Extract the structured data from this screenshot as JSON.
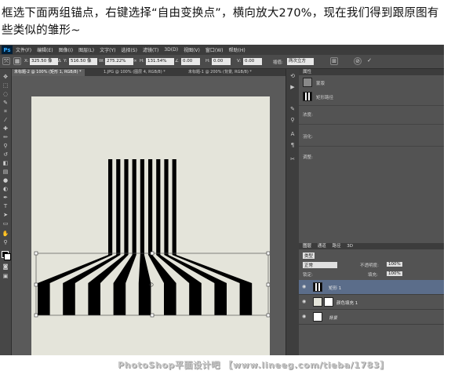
{
  "caption": "框选下面两组锚点，右键选择“自由变换点”，横向放大270%，现在我们得到跟原图有些类似的雏形~",
  "app": {
    "logo": "Ps",
    "menu": [
      "文件(F)",
      "编辑(E)",
      "图像(I)",
      "图层(L)",
      "文字(Y)",
      "选择(S)",
      "滤镜(T)",
      "3D(D)",
      "视图(V)",
      "窗口(W)",
      "帮助(H)"
    ]
  },
  "options": {
    "x_label": "X:",
    "x_value": "325.50 像",
    "y_label": "Y:",
    "y_value": "516.50 像",
    "w_label": "W:",
    "w_value": "275.22%",
    "h_label": "H:",
    "h_value": "131.54%",
    "angle_value": "0.00",
    "h_skew_label": "H:",
    "h_skew_value": "0.00",
    "v_skew_label": "V:",
    "v_skew_value": "0.00",
    "interp_label": "插值:",
    "interp_value": "两次立方",
    "cancel_icon": "cancel-icon",
    "commit_icon": "check-icon"
  },
  "tabs": [
    {
      "label": "未标题-2 @ 100% (矩形 1, RGB/8) *",
      "active": true
    },
    {
      "label": "1.JPG @ 100% (图层 4, RGB/8) *",
      "active": false
    },
    {
      "label": "未标题-1 @ 200% (背景, RGB/8) *",
      "active": false
    }
  ],
  "panels": {
    "properties_title": "属性",
    "mask_label": "蒙版",
    "path_label": "矩形路径",
    "density_label": "浓度:",
    "feather_label": "羽化:",
    "adjust_label": "调整:"
  },
  "layers_panel": {
    "tabs": [
      "图层",
      "通道",
      "路径",
      "3D"
    ],
    "kind_label": "类型",
    "blend_mode": "正常",
    "opacity_label": "不透明度:",
    "opacity_value": "100%",
    "lock_label": "锁定:",
    "fill_label": "填充:",
    "fill_value": "100%",
    "layers": [
      {
        "name": "矩形 1",
        "selected": true
      },
      {
        "name": "颜色填充 1",
        "selected": false
      },
      {
        "name": "背景",
        "selected": false
      }
    ]
  },
  "watermark": "PhotoShop平面设计吧 【www.lineeg.com/tieba/1783】",
  "colors": {
    "ps_bg": "#535353",
    "doc_bg": "#e4e4da",
    "stripe": "#000000",
    "selection": "#5b6d8a"
  }
}
